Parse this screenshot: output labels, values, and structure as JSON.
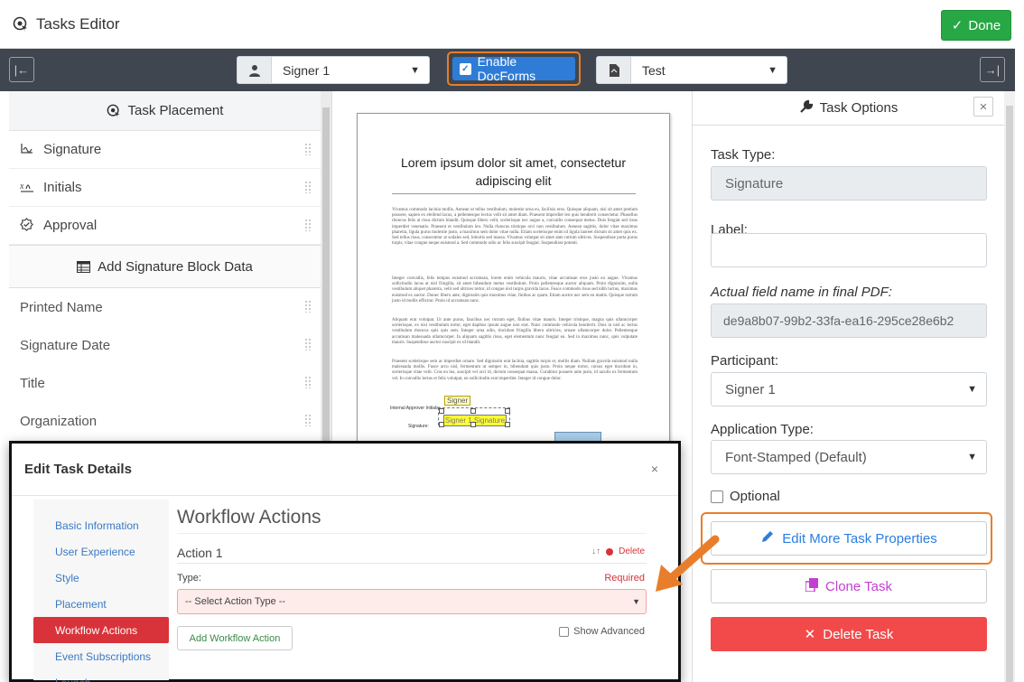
{
  "titlebar": {
    "title": "Tasks Editor",
    "done_label": "Done"
  },
  "toolbar": {
    "signer_value": "Signer 1",
    "docforms_label": "Enable DocForms",
    "docforms_checked": true,
    "document_value": "Test"
  },
  "left_panel": {
    "task_placement_title": "Task Placement",
    "tasks": [
      {
        "label": "Signature",
        "icon": "signature-icon"
      },
      {
        "label": "Initials",
        "icon": "initials-icon"
      },
      {
        "label": "Approval",
        "icon": "approval-check-icon"
      }
    ],
    "signature_block_title": "Add Signature Block Data",
    "block_fields": [
      "Printed Name",
      "Signature Date",
      "Title",
      "Organization"
    ]
  },
  "document": {
    "title": "Lorem ipsum dolor sit amet, consectetur adipiscing elit",
    "paragraphs": [
      "Vivamus commodo lacinia mollis. Aenean ut tellus vestibulum, molestie urna eu, facilisis eros. Quisque aliquam, nisi sit amet pretium posuere, sapien ex eleifend lacus, a pellentesque lectus velit sit amet diam. Praesent imperdiet leo quis hendrerit consectetur. Phasellus rhoncus felis at risus dictum blandit. Quisque libero velit, scelerisque nec augue a, convallis consequat metus. Duis feugiat sed risus imperdiet venenatis. Praesent et vestibulum leo. Nulla rhoncus tristique orci non vestibulum. Aenean sagittis, dolor vitae maximus pharetra, ligula purus molestie justo, a maximus sem dolor vitae nulla. Etiam scelerisque enim id ligula laoreet dictum sit amet quis ex. Sed tellus risus, consectetur at sodales sed, lobortis sed massa. Vivamus volutpat sit amet ante rutrum ultrices. Suspendisse porta purus turpis, vitae congue neque euismod a. Sed commodo odio ac felis suscipit feugiat. Suspendisse potenti.",
      "Integer convallis, felis tempus euismod accumsan, lorem enim vehicula mauris, vitae accumsan eros justo eu augue. Vivamus sollicitudin lacus at nisl fringilla, sit amet bibendum metus vestibulum. Proin pellentesque auctor aliquam. Proin dignissim, nulla vestibulum aliquet pharetra, velit sed ultrices tortor, id congue nisl turpis gravida lacus. Fusce commodo risus sed nibh luctus, maximus euismod ex auctor. Donec libero ante, dignissim quis maximus vitae, finibus ac quam. Etiam auctor nec sem eu mattis. Quisque rutrum justo id mollis efficitur. Proin id accumsan nunc.",
      "Aliquam erat volutpat. Ut ante purus, faucibus nec rutrum eget, finibus vitae mauris. Integer tristique, magna quis ullamcorper scelerisque, ex nisl vestibulum tortor, eget dapibus ipsum augue non erat. Nunc commodo vehicula hendrerit. Duis in nisl ac lectus vestibulum rhoncus quis quis sem. Integer urna odio, tincidunt fringilla libero ultricies, ornare ullamcorper dolor. Pellentesque accumsan malesuada ullamcorper. In aliquam sagittis risus, eget elementum nunc feugiat eu. Sed in maximus nunc, quis vulputate mauris. Suspendisse auctor suscipit ex id blandit.",
      "Praesent scelerisque sem ac imperdiet ornare. Sed dignissim erat lacinia, sagittis turpis et, mollis diam. Nullam gravida euismod nulla malesuada mollis. Fusce arcu nisl, fermentum ut semper in, bibendum quis justo. Proin neque tortor, cursus eget tincidunt in, scelerisque vitae velit. Cras eu leo, suscipit vel orci id, dictum consequat massa. Curabitur posuere ante justo, id iaculis ex fermentum vel. In convallis lectus et felis volutpat, eu sollicitudin erat imperdiet. Integer id congue dolor."
    ],
    "signer_tag": "Signer",
    "internal_approver_label": "Internal Approver Initials:",
    "signature_label": "Signature:",
    "signature_field_text": "Signer 1 Signature"
  },
  "right_panel": {
    "title": "Task Options",
    "task_type_label": "Task Type:",
    "task_type_value": "Signature",
    "label_label": "Label:",
    "label_value": "",
    "actual_field_label": "Actual field name in final PDF:",
    "actual_field_value": "de9a8b07-99b2-33fa-ea16-295ce28e6b2",
    "participant_label": "Participant:",
    "participant_value": "Signer 1",
    "application_type_label": "Application Type:",
    "application_type_value": "Font-Stamped (Default)",
    "optional_label": "Optional",
    "optional_checked": false,
    "edit_more_label": "Edit More Task Properties",
    "clone_label": "Clone Task",
    "delete_label": "Delete Task"
  },
  "modal": {
    "title": "Edit Task Details",
    "close_label": "×",
    "nav": [
      "Basic Information",
      "User Experience",
      "Style",
      "Placement",
      "Workflow Actions",
      "Event Subscriptions",
      "Launch"
    ],
    "active_nav": "Workflow Actions",
    "section_title": "Workflow Actions",
    "action_title": "Action 1",
    "delete_label": "Delete",
    "type_label": "Type:",
    "required_label": "Required",
    "select_placeholder": "-- Select Action Type --",
    "add_action_label": "Add Workflow Action",
    "show_advanced_label": "Show Advanced"
  },
  "colors": {
    "toolbar": "#3f464f",
    "done_green": "#28a745",
    "accent_blue": "#2f7cd7",
    "highlight_orange": "#e87e2b",
    "danger_red": "#f24a4a",
    "nav_active": "#d8333a"
  }
}
